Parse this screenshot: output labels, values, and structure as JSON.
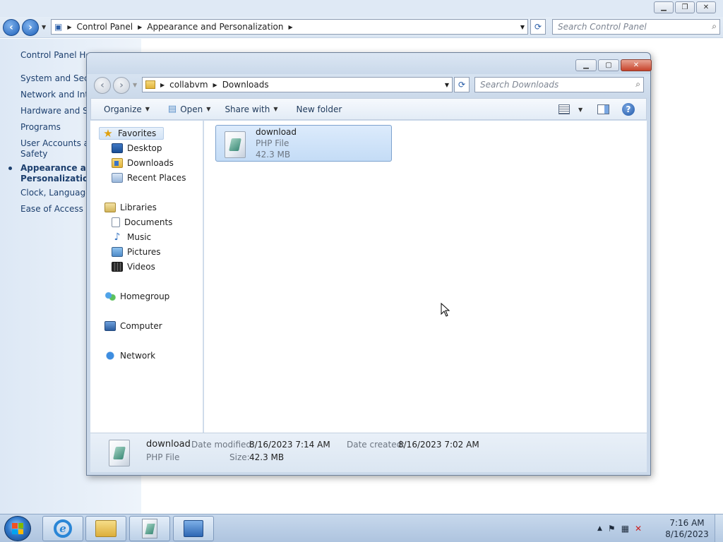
{
  "control_panel": {
    "address": [
      "Control Panel",
      "Appearance and Personalization"
    ],
    "search_placeholder": "Search Control Panel",
    "links": [
      "Control Panel Home",
      "System and Security",
      "Network and Internet",
      "Hardware and Sound",
      "Programs",
      "User Accounts and",
      "Safety",
      "Appearance and",
      "Personalization",
      "Clock, Language,",
      "Ease of Access"
    ]
  },
  "explorer": {
    "address": [
      "collabvm",
      "Downloads"
    ],
    "search_placeholder": "Search Downloads",
    "toolbar": {
      "organize": "Organize",
      "open": "Open",
      "share_with": "Share with",
      "new_folder": "New folder"
    },
    "nav": {
      "favorites": "Favorites",
      "desktop": "Desktop",
      "downloads": "Downloads",
      "recent_places": "Recent Places",
      "libraries": "Libraries",
      "documents": "Documents",
      "music": "Music",
      "pictures": "Pictures",
      "videos": "Videos",
      "homegroup": "Homegroup",
      "computer": "Computer",
      "network": "Network"
    },
    "files": [
      {
        "name": "download",
        "type": "PHP File",
        "size": "42.3 MB",
        "selected": true
      }
    ],
    "details": {
      "name": "download",
      "type": "PHP File",
      "date_modified_label": "Date modified:",
      "date_modified": "8/16/2023 7:14 AM",
      "date_created_label": "Date created:",
      "date_created": "8/16/2023 7:02 AM",
      "size_label": "Size:",
      "size": "42.3 MB"
    }
  },
  "taskbar": {
    "time": "7:16 AM",
    "date": "8/16/2023",
    "pinned": [
      "internet-explorer-icon",
      "windows-explorer-icon",
      "php-file-icon",
      "control-panel-icon"
    ]
  },
  "colors": {
    "accent": "#1c3f6e",
    "selection": "#cce2fa",
    "window_frame": "#cbd9ea"
  }
}
